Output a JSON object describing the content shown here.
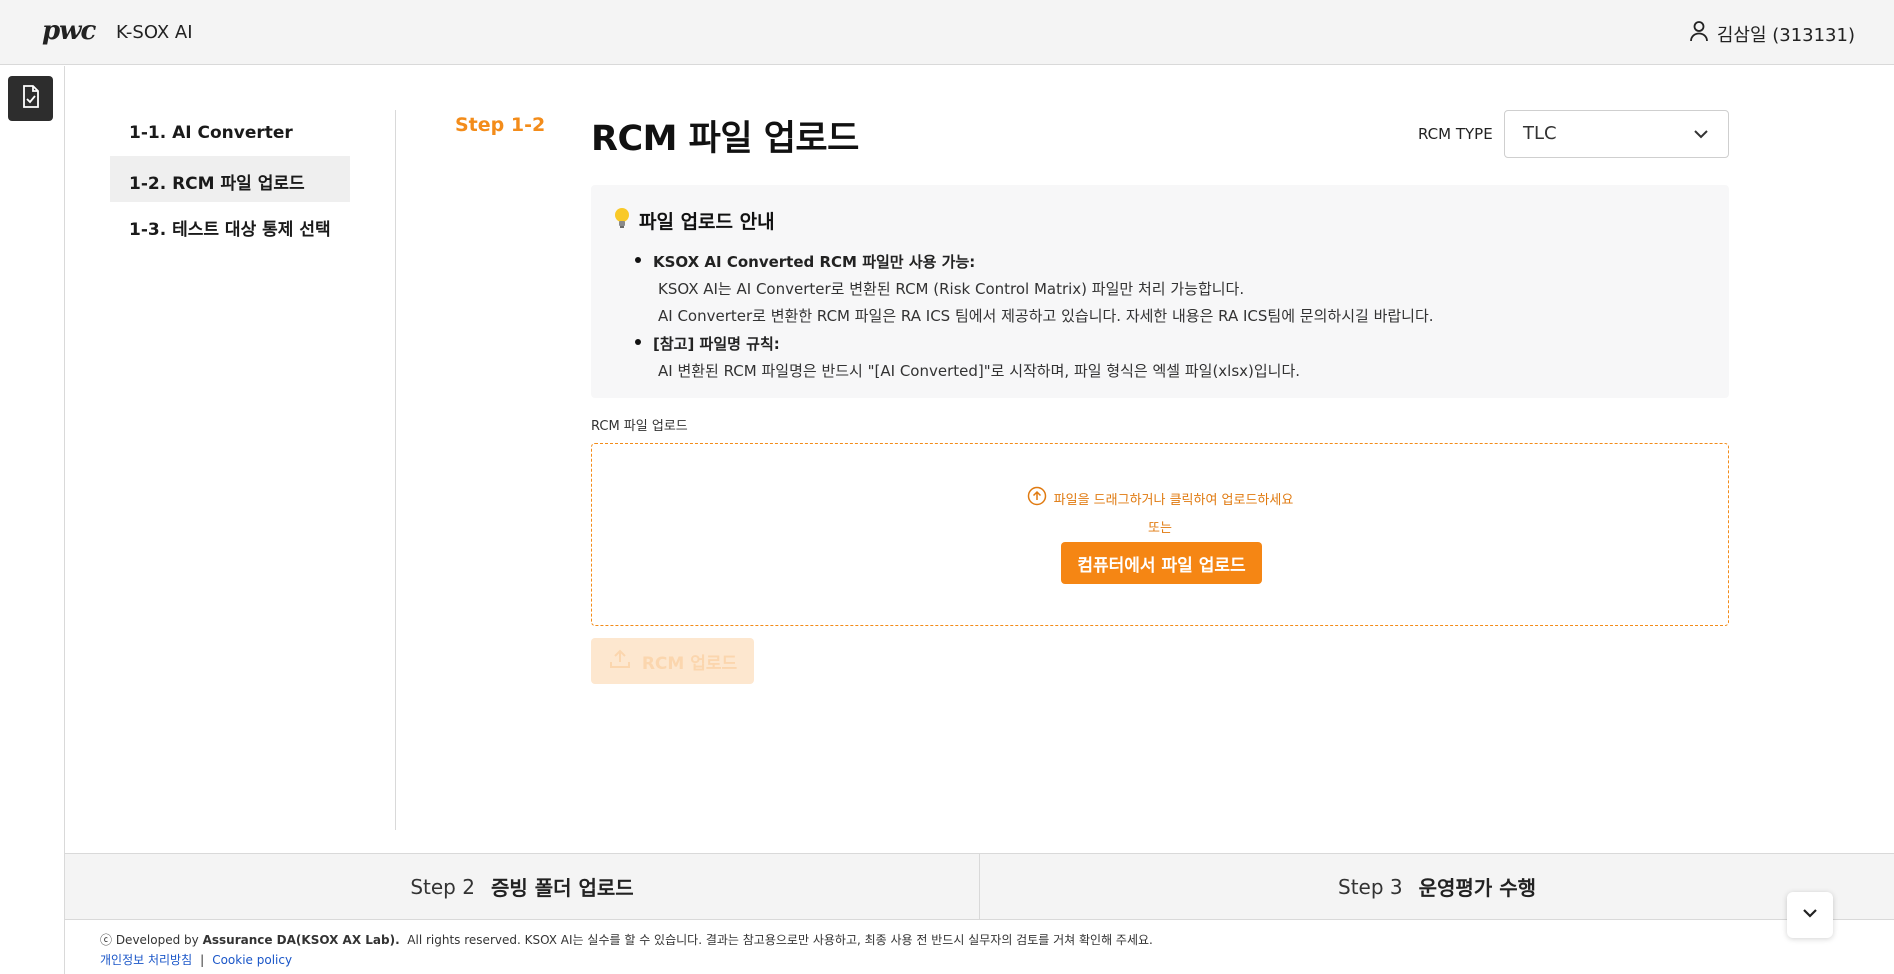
{
  "header": {
    "logo": "pwc",
    "app_name": "K-SOX AI",
    "user": "김삼일 (313131)",
    "user_icon": "user-icon"
  },
  "rail": {
    "doc_icon": "document-check-icon",
    "expand_icon": "double-chevron-right-icon"
  },
  "subnav": {
    "items": [
      {
        "label": "1-1. AI Converter"
      },
      {
        "label": "1-2. RCM 파일 업로드"
      },
      {
        "label": "1-3. 테스트 대상 통제 선택"
      }
    ],
    "active_index": 1
  },
  "main": {
    "step_label": "Step 1-2",
    "title": "RCM 파일 업로드",
    "rcm_type_label": "RCM TYPE",
    "rcm_type_value": "TLC",
    "guide": {
      "title": "파일 업로드 안내",
      "bullets": [
        {
          "head": "KSOX AI Converted RCM 파일만 사용 가능:",
          "lines": [
            "KSOX AI는 AI Converter로 변환된 RCM (Risk Control Matrix) 파일만 처리 가능합니다.",
            "AI Converter로 변환한 RCM 파일은 RA ICS 팀에서 제공하고 있습니다. 자세한 내용은 RA ICS팀에 문의하시길 바랍니다."
          ]
        },
        {
          "head": "[참고] 파일명 규칙:",
          "lines": [
            "AI 변환된 RCM 파일명은 반드시 \"[AI Converted]\"로 시작하며, 파일 형식은 엑셀 파일(xlsx)입니다."
          ]
        }
      ]
    },
    "upload_label": "RCM 파일 업로드",
    "drop_hint": "파일을 드래그하거나 클릭하여 업로드하세요",
    "drop_or": "또는",
    "pc_upload_button": "컴퓨터에서 파일 업로드",
    "rcm_upload_button": "RCM 업로드"
  },
  "steps": [
    {
      "num": "Step 2",
      "name": "증빙 폴더 업로드"
    },
    {
      "num": "Step 3",
      "name": "운영평가 수행"
    }
  ],
  "footer": {
    "copyright_prefix": "ⓒ Developed by ",
    "developer": "Assurance DA(KSOX AX Lab).",
    "notice": "All rights reserved.   KSOX AI는 실수를 할 수 있습니다. 결과는 참고용으로만 사용하고, 최종 사용 전 반드시 실무자의 검토를 거쳐 확인해 주세요.",
    "privacy_link": "개인정보 처리방침",
    "separator": "|",
    "cookie_link": "Cookie policy"
  },
  "colors": {
    "accent": "#f58614",
    "accent_text": "#f38c1a",
    "disabled_button_bg": "#fde7cf",
    "link": "#1a56c8"
  }
}
